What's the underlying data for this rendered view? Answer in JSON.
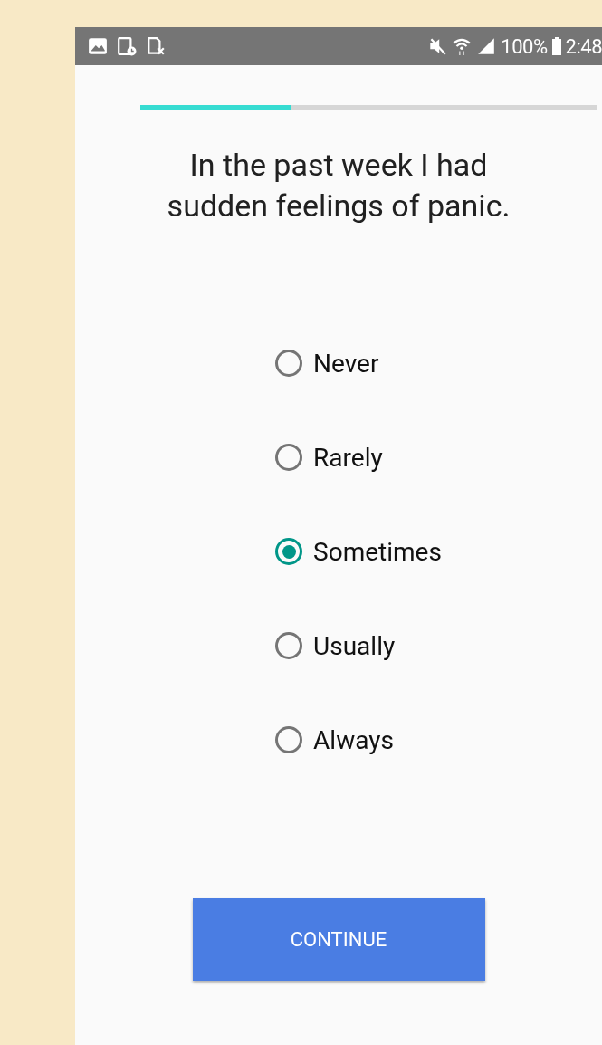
{
  "status_bar": {
    "battery_text": "100%",
    "time": "2:48"
  },
  "progress": {
    "level": 0.33
  },
  "question": "In the past week I had sudden feelings of panic.",
  "options": [
    {
      "label": "Never",
      "selected": false
    },
    {
      "label": "Rarely",
      "selected": false
    },
    {
      "label": "Sometimes",
      "selected": true
    },
    {
      "label": "Usually",
      "selected": false
    },
    {
      "label": "Always",
      "selected": false
    }
  ],
  "button": "CONTINUE"
}
